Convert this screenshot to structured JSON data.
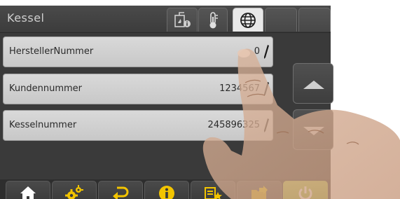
{
  "header": {
    "title": "Kessel"
  },
  "tabs": [
    {
      "icon": "boiler-info-icon"
    },
    {
      "icon": "thermometer-icon"
    },
    {
      "icon": "globe-icon",
      "active": true
    },
    {
      "icon": "empty"
    },
    {
      "icon": "empty"
    }
  ],
  "rows": [
    {
      "label": "HerstellerNummer",
      "value": "0"
    },
    {
      "label": "Kundennummer",
      "value": "1234567"
    },
    {
      "label": "Kesselnummer",
      "value": "245896325"
    }
  ],
  "side_buttons": [
    {
      "icon": "arrow-up-icon"
    },
    {
      "icon": "arrow-down-icon"
    }
  ],
  "bottom_bar": [
    {
      "icon": "home-icon"
    },
    {
      "icon": "settings-gears-icon"
    },
    {
      "icon": "back-arrow-icon"
    },
    {
      "icon": "info-icon"
    },
    {
      "icon": "list-star-icon"
    },
    {
      "icon": "folder-export-icon"
    },
    {
      "icon": "power-icon"
    }
  ],
  "colors": {
    "accent_yellow": "#f2c400",
    "power_green": "#9fbe3a",
    "panel_dark": "#3a3a3a",
    "row_bg": "#d2d2d2"
  }
}
